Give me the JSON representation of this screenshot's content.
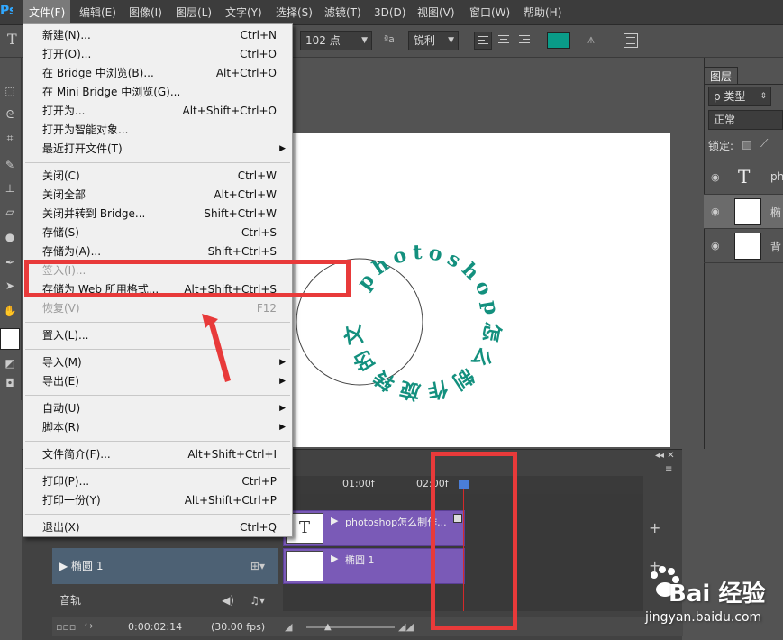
{
  "menubar": {
    "logo": "Ps",
    "items": [
      "文件(F)",
      "编辑(E)",
      "图像(I)",
      "图层(L)",
      "文字(Y)",
      "选择(S)",
      "滤镜(T)",
      "3D(D)",
      "视图(V)",
      "窗口(W)",
      "帮助(H)"
    ]
  },
  "options": {
    "font_size": "102 点",
    "aa_icon": "ªa",
    "aa_mode": "锐利",
    "text_color": "#0a9b88"
  },
  "file_menu": {
    "items": [
      {
        "label": "新建(N)...",
        "shortcut": "Ctrl+N"
      },
      {
        "label": "打开(O)...",
        "shortcut": "Ctrl+O"
      },
      {
        "label": "在 Bridge 中浏览(B)...",
        "shortcut": "Alt+Ctrl+O"
      },
      {
        "label": "在 Mini Bridge 中浏览(G)...",
        "shortcut": ""
      },
      {
        "label": "打开为...",
        "shortcut": "Alt+Shift+Ctrl+O"
      },
      {
        "label": "打开为智能对象...",
        "shortcut": ""
      },
      {
        "label": "最近打开文件(T)",
        "shortcut": "",
        "submenu": true
      },
      {
        "label": "关闭(C)",
        "shortcut": "Ctrl+W"
      },
      {
        "label": "关闭全部",
        "shortcut": "Alt+Ctrl+W"
      },
      {
        "label": "关闭并转到 Bridge...",
        "shortcut": "Shift+Ctrl+W"
      },
      {
        "label": "存储(S)",
        "shortcut": "Ctrl+S"
      },
      {
        "label": "存储为(A)...",
        "shortcut": "Shift+Ctrl+S"
      },
      {
        "label": "签入(I)...",
        "shortcut": "",
        "disabled": true
      },
      {
        "label": "存储为 Web 所用格式...",
        "shortcut": "Alt+Shift+Ctrl+S"
      },
      {
        "label": "恢复(V)",
        "shortcut": "F12",
        "disabled": true
      },
      {
        "label": "置入(L)...",
        "shortcut": ""
      },
      {
        "label": "导入(M)",
        "shortcut": "",
        "submenu": true
      },
      {
        "label": "导出(E)",
        "shortcut": "",
        "submenu": true
      },
      {
        "label": "自动(U)",
        "shortcut": "",
        "submenu": true
      },
      {
        "label": "脚本(R)",
        "shortcut": "",
        "submenu": true
      },
      {
        "label": "文件简介(F)...",
        "shortcut": "Alt+Shift+Ctrl+I"
      },
      {
        "label": "打印(P)...",
        "shortcut": "Ctrl+P"
      },
      {
        "label": "打印一份(Y)",
        "shortcut": "Alt+Shift+Ctrl+P"
      },
      {
        "label": "退出(X)",
        "shortcut": "Ctrl+Q"
      }
    ]
  },
  "canvas": {
    "circle_text": "photoshop怎么制作旋转的文字效果？"
  },
  "layers_panel": {
    "tab": "图层",
    "filter": "ρ 类型",
    "blend": "正常",
    "lock_label": "锁定:",
    "layers": [
      {
        "name": "ph",
        "kind": "text"
      },
      {
        "name": "椭",
        "kind": "shape"
      },
      {
        "name": "背",
        "kind": "fill"
      }
    ]
  },
  "timeline": {
    "ticks": [
      "01:00f",
      "02:00f"
    ],
    "tracks": [
      {
        "label": "",
        "clip": "photoshop怎么制作..."
      },
      {
        "label": "椭圆 1",
        "clip": "椭圆 1"
      }
    ],
    "audio_label": "音轨",
    "timecode": "0:00:02:14",
    "fps": "(30.00 fps)"
  },
  "watermark": {
    "brand": "Bai 经验",
    "url": "jingyan.baidu.com"
  },
  "colors": {
    "accent_red": "#e83a3a",
    "clip_purple": "#7a5ab7",
    "track_label_blue": "#4d6174"
  }
}
